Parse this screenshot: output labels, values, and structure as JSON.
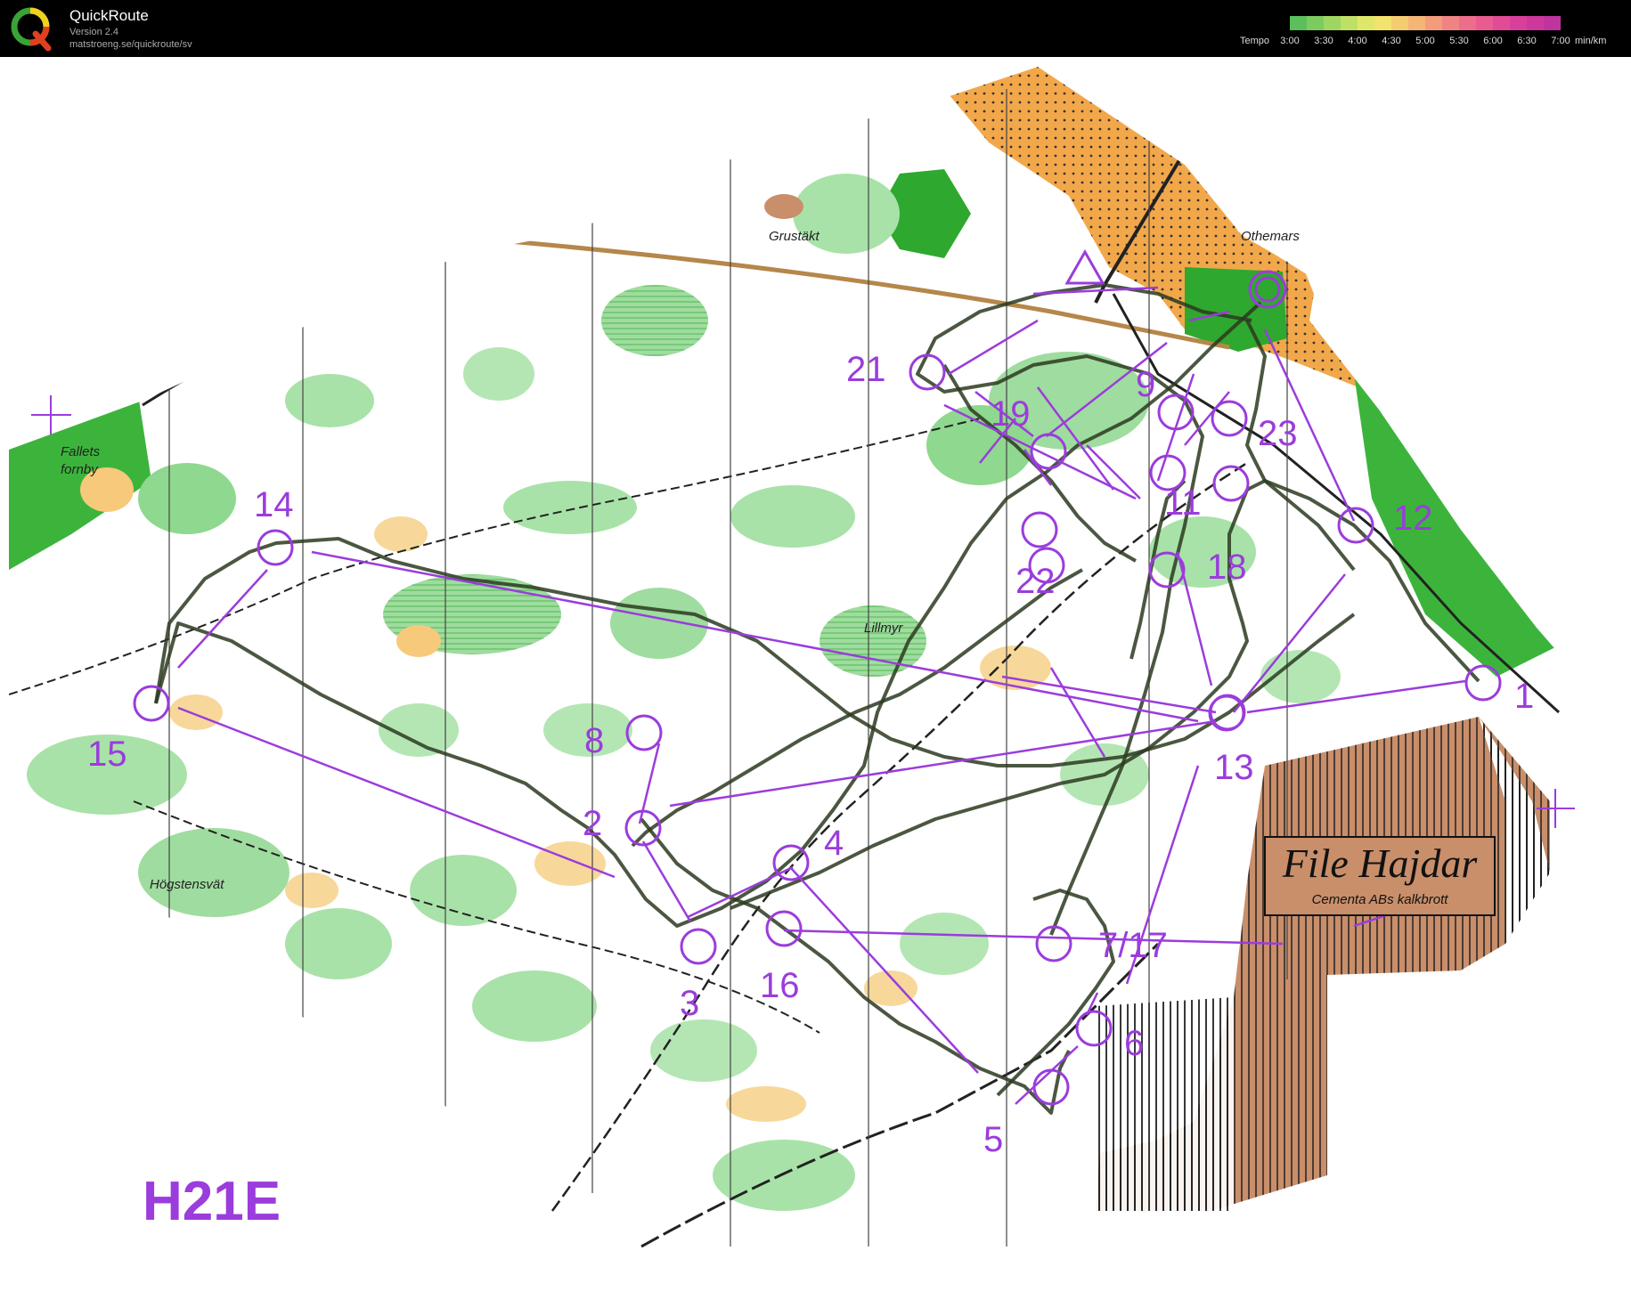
{
  "app": {
    "name": "QuickRoute",
    "version": "Version 2.4",
    "url": "matstroeng.se/quickroute/sv"
  },
  "legend": {
    "label": "Tempo",
    "ticks": [
      "3:00",
      "3:30",
      "4:00",
      "4:30",
      "5:00",
      "5:30",
      "6:00",
      "6:30",
      "7:00"
    ],
    "unit": "min/km"
  },
  "map": {
    "class_label": "H21E",
    "place_names": {
      "grustakt": "Grustäkt",
      "othemars": "Othemars",
      "fallets_1": "Fallets",
      "fallets_2": "fornby",
      "lillmyr": "Lillmyr",
      "hogstensvat": "Högstensvät"
    },
    "quarry": {
      "title": "File Hajdar",
      "subtitle": "Cementa ABs kalkbrott"
    },
    "controls": [
      "1",
      "2",
      "3",
      "4",
      "5",
      "6",
      "7/17",
      "8",
      "9",
      "11",
      "12",
      "13",
      "14",
      "15",
      "16",
      "18",
      "19",
      "21",
      "22",
      "23"
    ],
    "colors": {
      "course": "#9b3cdc",
      "forest_green": "#6fcf6f",
      "dark_green": "#2ea82e",
      "open_yellow": "#f7c97a",
      "urban_orange": "#f2a84a",
      "quarry_brown": "#c98e6a",
      "route": "#2c3a20"
    }
  }
}
